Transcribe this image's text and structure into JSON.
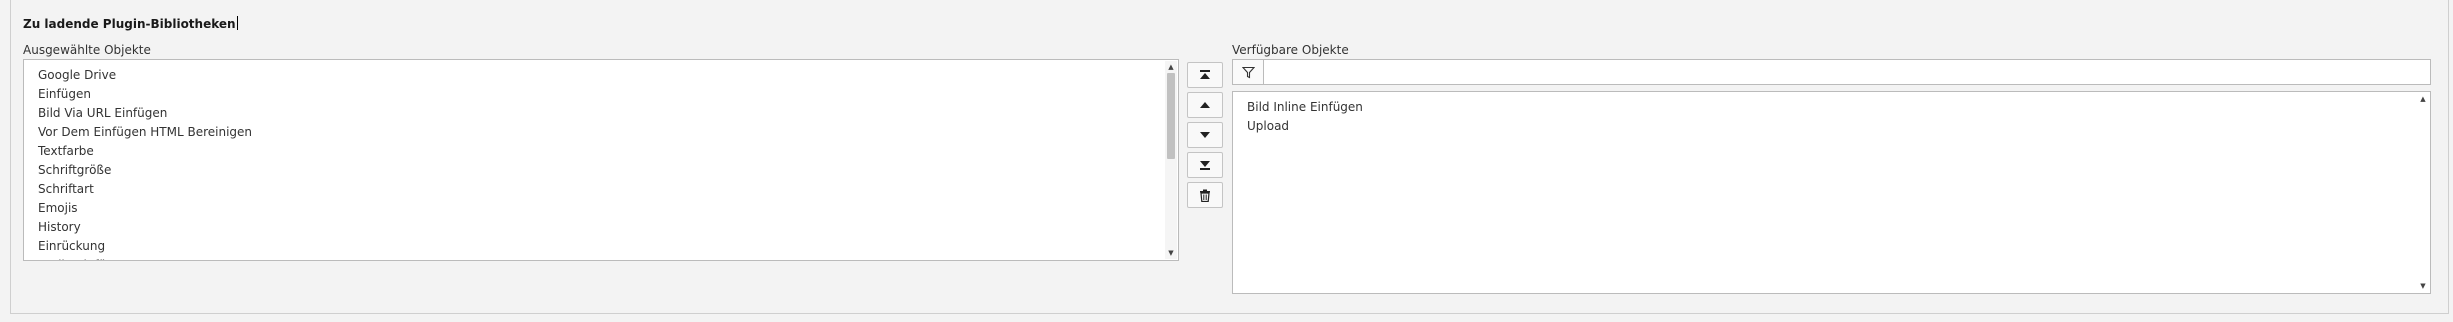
{
  "section": {
    "title": "Zu ladende Plugin-Bibliotheken"
  },
  "selected": {
    "label": "Ausgewählte Objekte",
    "items": [
      "Google Drive",
      "Einfügen",
      "Bild Via URL Einfügen",
      "Vor Dem Einfügen HTML Bereinigen",
      "Textfarbe",
      "Schriftgröße",
      "Schriftart",
      "Emojis",
      "History",
      "Einrückung",
      "Audio Einfügen"
    ]
  },
  "controls": {
    "move_top_icon": "move-to-top-icon",
    "move_up_icon": "move-up-icon",
    "move_down_icon": "move-down-icon",
    "move_bottom_icon": "move-to-bottom-icon",
    "remove_icon": "trash-icon"
  },
  "available": {
    "label": "Verfügbare Objekte",
    "filter_value": "",
    "items": [
      "Bild Inline Einfügen",
      "Upload"
    ]
  }
}
